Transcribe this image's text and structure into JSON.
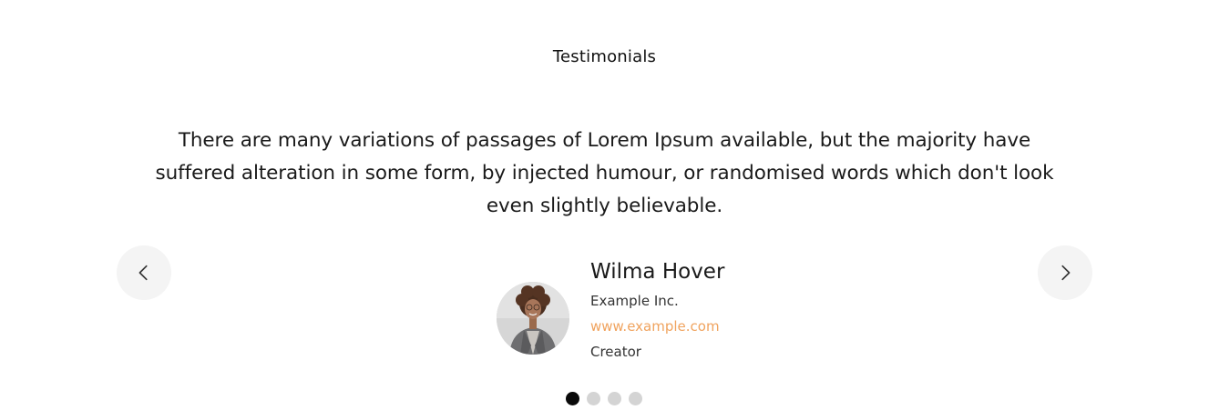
{
  "section": {
    "title": "Testimonials"
  },
  "testimonial": {
    "quote": "There are many variations of passages of Lorem Ipsum available, but the majority have suffered alteration in some form, by injected humour, or randomised words which don't look even slightly believable.",
    "author": {
      "name": "Wilma Hover",
      "company": "Example Inc.",
      "website": "www.example.com",
      "role": "Creator"
    }
  },
  "navigation": {
    "prev_icon": "chevron-left-icon",
    "next_icon": "chevron-right-icon"
  },
  "pagination": {
    "total": 4,
    "active_index": 0
  },
  "colors": {
    "accent_link": "#f0a35e",
    "nav_button_bg": "#f4f4f4",
    "dot_active": "#0a0a0a",
    "dot_inactive": "#d4d4d4"
  }
}
